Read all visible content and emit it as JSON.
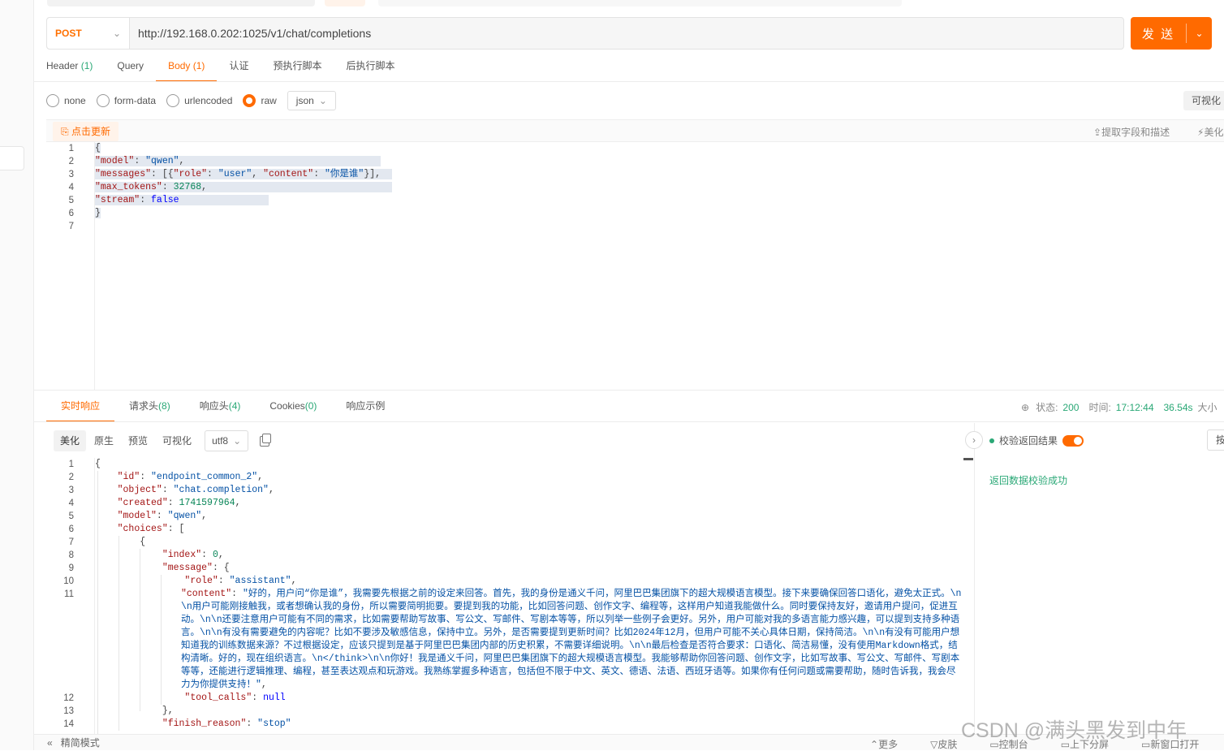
{
  "request": {
    "method": "POST",
    "url": "http://192.168.0.202:1025/v1/chat/completions",
    "send_label": "发 送",
    "tabs": [
      {
        "label": "Header",
        "count": "(1)"
      },
      {
        "label": "Query",
        "count": ""
      },
      {
        "label": "Body",
        "count": "(1)"
      },
      {
        "label": "认证",
        "count": ""
      },
      {
        "label": "预执行脚本",
        "count": ""
      },
      {
        "label": "后执行脚本",
        "count": ""
      }
    ],
    "body_types": [
      "none",
      "form-data",
      "urlencoded",
      "raw"
    ],
    "selected_body_type": "raw",
    "format": "json",
    "visualize_label": "可视化",
    "refresh_label": "点击更新",
    "extract_label": "提取字段和描述",
    "beautify_label": "美化",
    "line_numbers": [
      "1",
      "2",
      "3",
      "4",
      "5",
      "6",
      "7"
    ]
  },
  "response": {
    "tabs": [
      {
        "label": "实时响应",
        "count": ""
      },
      {
        "label": "请求头",
        "count": "(8)"
      },
      {
        "label": "响应头",
        "count": "(4)"
      },
      {
        "label": "Cookies",
        "count": "(0)"
      },
      {
        "label": "响应示例",
        "count": ""
      }
    ],
    "status_label": "状态:",
    "status_value": "200",
    "time_label": "时间:",
    "time_value": "17:12:44",
    "duration_value": "36.54s",
    "size_label": "大小",
    "view_modes": [
      "美化",
      "原生",
      "预览",
      "可视化"
    ],
    "encoding": "utf8",
    "line_numbers": [
      "1",
      "2",
      "3",
      "4",
      "5",
      "6",
      "7",
      "8",
      "9",
      "10",
      "11",
      "12",
      "13",
      "14"
    ],
    "validate_label": "校验返回结果",
    "validate_success": "返回数据校验成功",
    "right_button": "按"
  },
  "footer": {
    "simple_mode": "精简模式",
    "more": "更多",
    "skin": "皮肤",
    "console": "控制台",
    "split": "上下分屏",
    "new_window": "新窗口打开"
  },
  "watermark": "CSDN @满头黑发到中年",
  "colors": {
    "accent": "#ff6a00",
    "success": "#2aa876"
  }
}
